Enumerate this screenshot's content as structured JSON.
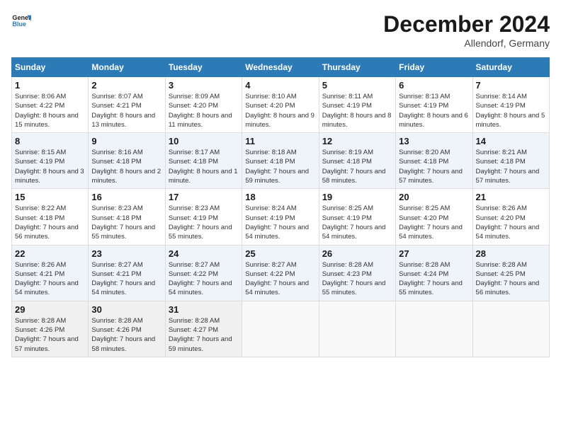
{
  "header": {
    "logo_line1": "General",
    "logo_line2": "Blue",
    "month_title": "December 2024",
    "location": "Allendorf, Germany"
  },
  "days_of_week": [
    "Sunday",
    "Monday",
    "Tuesday",
    "Wednesday",
    "Thursday",
    "Friday",
    "Saturday"
  ],
  "weeks": [
    [
      {
        "day": "1",
        "sunrise": "8:06 AM",
        "sunset": "4:22 PM",
        "daylight": "8 hours and 15 minutes."
      },
      {
        "day": "2",
        "sunrise": "8:07 AM",
        "sunset": "4:21 PM",
        "daylight": "8 hours and 13 minutes."
      },
      {
        "day": "3",
        "sunrise": "8:09 AM",
        "sunset": "4:20 PM",
        "daylight": "8 hours and 11 minutes."
      },
      {
        "day": "4",
        "sunrise": "8:10 AM",
        "sunset": "4:20 PM",
        "daylight": "8 hours and 9 minutes."
      },
      {
        "day": "5",
        "sunrise": "8:11 AM",
        "sunset": "4:19 PM",
        "daylight": "8 hours and 8 minutes."
      },
      {
        "day": "6",
        "sunrise": "8:13 AM",
        "sunset": "4:19 PM",
        "daylight": "8 hours and 6 minutes."
      },
      {
        "day": "7",
        "sunrise": "8:14 AM",
        "sunset": "4:19 PM",
        "daylight": "8 hours and 5 minutes."
      }
    ],
    [
      {
        "day": "8",
        "sunrise": "8:15 AM",
        "sunset": "4:19 PM",
        "daylight": "8 hours and 3 minutes."
      },
      {
        "day": "9",
        "sunrise": "8:16 AM",
        "sunset": "4:18 PM",
        "daylight": "8 hours and 2 minutes."
      },
      {
        "day": "10",
        "sunrise": "8:17 AM",
        "sunset": "4:18 PM",
        "daylight": "8 hours and 1 minute."
      },
      {
        "day": "11",
        "sunrise": "8:18 AM",
        "sunset": "4:18 PM",
        "daylight": "7 hours and 59 minutes."
      },
      {
        "day": "12",
        "sunrise": "8:19 AM",
        "sunset": "4:18 PM",
        "daylight": "7 hours and 58 minutes."
      },
      {
        "day": "13",
        "sunrise": "8:20 AM",
        "sunset": "4:18 PM",
        "daylight": "7 hours and 57 minutes."
      },
      {
        "day": "14",
        "sunrise": "8:21 AM",
        "sunset": "4:18 PM",
        "daylight": "7 hours and 57 minutes."
      }
    ],
    [
      {
        "day": "15",
        "sunrise": "8:22 AM",
        "sunset": "4:18 PM",
        "daylight": "7 hours and 56 minutes."
      },
      {
        "day": "16",
        "sunrise": "8:23 AM",
        "sunset": "4:18 PM",
        "daylight": "7 hours and 55 minutes."
      },
      {
        "day": "17",
        "sunrise": "8:23 AM",
        "sunset": "4:19 PM",
        "daylight": "7 hours and 55 minutes."
      },
      {
        "day": "18",
        "sunrise": "8:24 AM",
        "sunset": "4:19 PM",
        "daylight": "7 hours and 54 minutes."
      },
      {
        "day": "19",
        "sunrise": "8:25 AM",
        "sunset": "4:19 PM",
        "daylight": "7 hours and 54 minutes."
      },
      {
        "day": "20",
        "sunrise": "8:25 AM",
        "sunset": "4:20 PM",
        "daylight": "7 hours and 54 minutes."
      },
      {
        "day": "21",
        "sunrise": "8:26 AM",
        "sunset": "4:20 PM",
        "daylight": "7 hours and 54 minutes."
      }
    ],
    [
      {
        "day": "22",
        "sunrise": "8:26 AM",
        "sunset": "4:21 PM",
        "daylight": "7 hours and 54 minutes."
      },
      {
        "day": "23",
        "sunrise": "8:27 AM",
        "sunset": "4:21 PM",
        "daylight": "7 hours and 54 minutes."
      },
      {
        "day": "24",
        "sunrise": "8:27 AM",
        "sunset": "4:22 PM",
        "daylight": "7 hours and 54 minutes."
      },
      {
        "day": "25",
        "sunrise": "8:27 AM",
        "sunset": "4:22 PM",
        "daylight": "7 hours and 54 minutes."
      },
      {
        "day": "26",
        "sunrise": "8:28 AM",
        "sunset": "4:23 PM",
        "daylight": "7 hours and 55 minutes."
      },
      {
        "day": "27",
        "sunrise": "8:28 AM",
        "sunset": "4:24 PM",
        "daylight": "7 hours and 55 minutes."
      },
      {
        "day": "28",
        "sunrise": "8:28 AM",
        "sunset": "4:25 PM",
        "daylight": "7 hours and 56 minutes."
      }
    ],
    [
      {
        "day": "29",
        "sunrise": "8:28 AM",
        "sunset": "4:26 PM",
        "daylight": "7 hours and 57 minutes."
      },
      {
        "day": "30",
        "sunrise": "8:28 AM",
        "sunset": "4:26 PM",
        "daylight": "7 hours and 58 minutes."
      },
      {
        "day": "31",
        "sunrise": "8:28 AM",
        "sunset": "4:27 PM",
        "daylight": "7 hours and 59 minutes."
      },
      null,
      null,
      null,
      null
    ]
  ],
  "labels": {
    "sunrise": "Sunrise:",
    "sunset": "Sunset:",
    "daylight": "Daylight:"
  }
}
